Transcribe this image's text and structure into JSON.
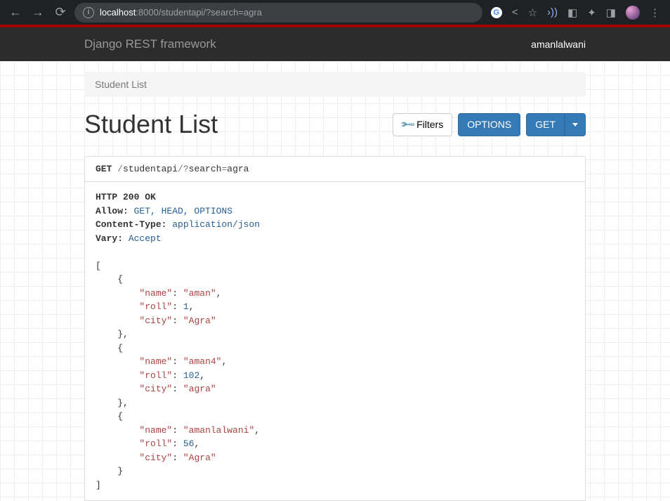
{
  "browser": {
    "url_host": "localhost",
    "url_port_path": ":8000/studentapi/?search=agra"
  },
  "navbar": {
    "brand": "Django REST framework",
    "user": "amanlalwani"
  },
  "breadcrumb": "Student List",
  "page_title": "Student List",
  "buttons": {
    "filters": "Filters",
    "options": "OPTIONS",
    "get": "GET"
  },
  "request": {
    "method": "GET",
    "path_pre": " /",
    "path_seg1": "studentapi",
    "path_mid": "/?",
    "path_seg2": "search",
    "path_eq": "=",
    "path_seg3": "agra"
  },
  "response": {
    "status_line": "HTTP 200 OK",
    "headers": [
      {
        "key": "Allow:",
        "value": " GET, HEAD, OPTIONS"
      },
      {
        "key": "Content-Type:",
        "value": " application/json"
      },
      {
        "key": "Vary:",
        "value": " Accept"
      }
    ],
    "data": [
      {
        "name": "aman",
        "roll": 1,
        "city": "Agra"
      },
      {
        "name": "aman4",
        "roll": 102,
        "city": "agra"
      },
      {
        "name": "amanlalwani",
        "roll": 56,
        "city": "Agra"
      }
    ]
  }
}
